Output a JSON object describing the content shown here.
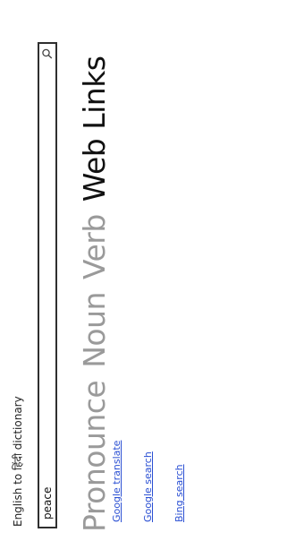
{
  "app": {
    "title": "English to हिंदी dictionary"
  },
  "search": {
    "value": "peace",
    "icon": "search-icon"
  },
  "pivot": {
    "tabs": [
      {
        "label": "Pronounce",
        "active": false
      },
      {
        "label": "Noun",
        "active": false
      },
      {
        "label": "Verb",
        "active": false
      },
      {
        "label": "Web Links",
        "active": true
      }
    ]
  },
  "links": [
    {
      "label": "Google translate"
    },
    {
      "label": "Google search"
    },
    {
      "label": "Bing search"
    }
  ],
  "colors": {
    "active_tab": "#111111",
    "inactive_tab": "#9a9a9a",
    "link": "#2a4fd3",
    "search_border": "#2f2f2f"
  }
}
